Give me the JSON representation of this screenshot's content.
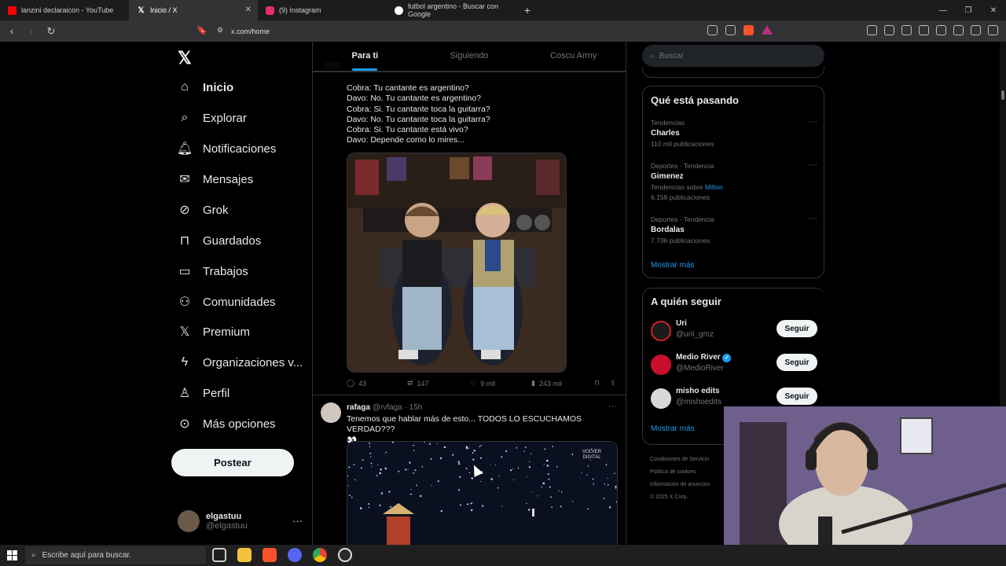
{
  "browser": {
    "tabs": [
      {
        "title": "lanzini declaraicon - YouTube",
        "color": "#ff0000"
      },
      {
        "title": "Inicio / X",
        "color": "#ffffff"
      },
      {
        "title": "(9) Instagram",
        "color": "#e1306c"
      },
      {
        "title": "futbol argentino - Buscar con Google",
        "color": "#4285f4"
      }
    ],
    "url": "x.com/home"
  },
  "nav": {
    "items": [
      {
        "label": "Inicio",
        "icon": "home-icon"
      },
      {
        "label": "Explorar",
        "icon": "search-icon"
      },
      {
        "label": "Notificaciones",
        "icon": "bell-icon"
      },
      {
        "label": "Mensajes",
        "icon": "envelope-icon"
      },
      {
        "label": "Grok",
        "icon": "grok-icon"
      },
      {
        "label": "Guardados",
        "icon": "bookmark-icon"
      },
      {
        "label": "Trabajos",
        "icon": "briefcase-icon"
      },
      {
        "label": "Comunidades",
        "icon": "people-icon"
      },
      {
        "label": "Premium",
        "icon": "x-icon"
      },
      {
        "label": "Organizaciones v...",
        "icon": "lightning-icon"
      },
      {
        "label": "Perfil",
        "icon": "person-icon"
      },
      {
        "label": "Más opciones",
        "icon": "more-circle-icon"
      }
    ],
    "post_label": "Postear",
    "account": {
      "name": "elgastuu",
      "handle": "@elgastuu"
    }
  },
  "feed": {
    "tabs": [
      "Para ti",
      "Siguiendo",
      "Coscu Army"
    ],
    "tweet1": {
      "lines": [
        "Cobra: Tu cantante es argentino?",
        "Davo: No. Tu cantante es argentino?",
        "Cobra: Si. Tu cantante toca la guitarra?",
        "Davo: No. Tu cantante toca la guitarra?",
        "Cobra: Si. Tu cantante está vivo?",
        "Davo: Depende como lo mires..."
      ],
      "replies": "43",
      "reposts": "147",
      "likes": "9 mil",
      "views": "243 mil"
    },
    "tweet2": {
      "name": "rafaga",
      "handle": "@rvfaga",
      "time": "15h",
      "text": "Tenemos que hablar más de esto... TODOS LO ESCUCHAMOS VERDAD???",
      "emoji": "👀",
      "video_watermark": "VOLVER DIGITAL"
    }
  },
  "right": {
    "search_placeholder": "Buscar",
    "trends_title": "Qué está pasando",
    "trends": [
      {
        "category": "Tendencias",
        "name": "Charles",
        "count": "110 mil publicaciones"
      },
      {
        "category": "Deportes · Tendencia",
        "name": "Gimenez",
        "count": "6.158 publicaciones",
        "extra_prefix": "Tendencias sobre",
        "extra_link": "Milton"
      },
      {
        "category": "Deportes · Tendencia",
        "name": "Bordalas",
        "count": "7.736 publicaciones"
      }
    ],
    "show_more": "Mostrar más",
    "follow_title": "A quién seguir",
    "follow": [
      {
        "name": "Uri",
        "handle": "@urii_gmz",
        "color": "#222"
      },
      {
        "name": "Medio River",
        "handle": "@MedioRiver",
        "color": "#c8102e",
        "verified": true
      },
      {
        "name": "misho edits",
        "handle": "@mishoedits",
        "color": "#d8d8d8"
      }
    ],
    "follow_btn": "Seguir",
    "footer": [
      "Condiciones de Servicio",
      "Política de cookies",
      "Información de anuncios",
      "© 2025 X Corp."
    ]
  },
  "taskbar": {
    "search_placeholder": "Escribe aquí para buscar."
  }
}
